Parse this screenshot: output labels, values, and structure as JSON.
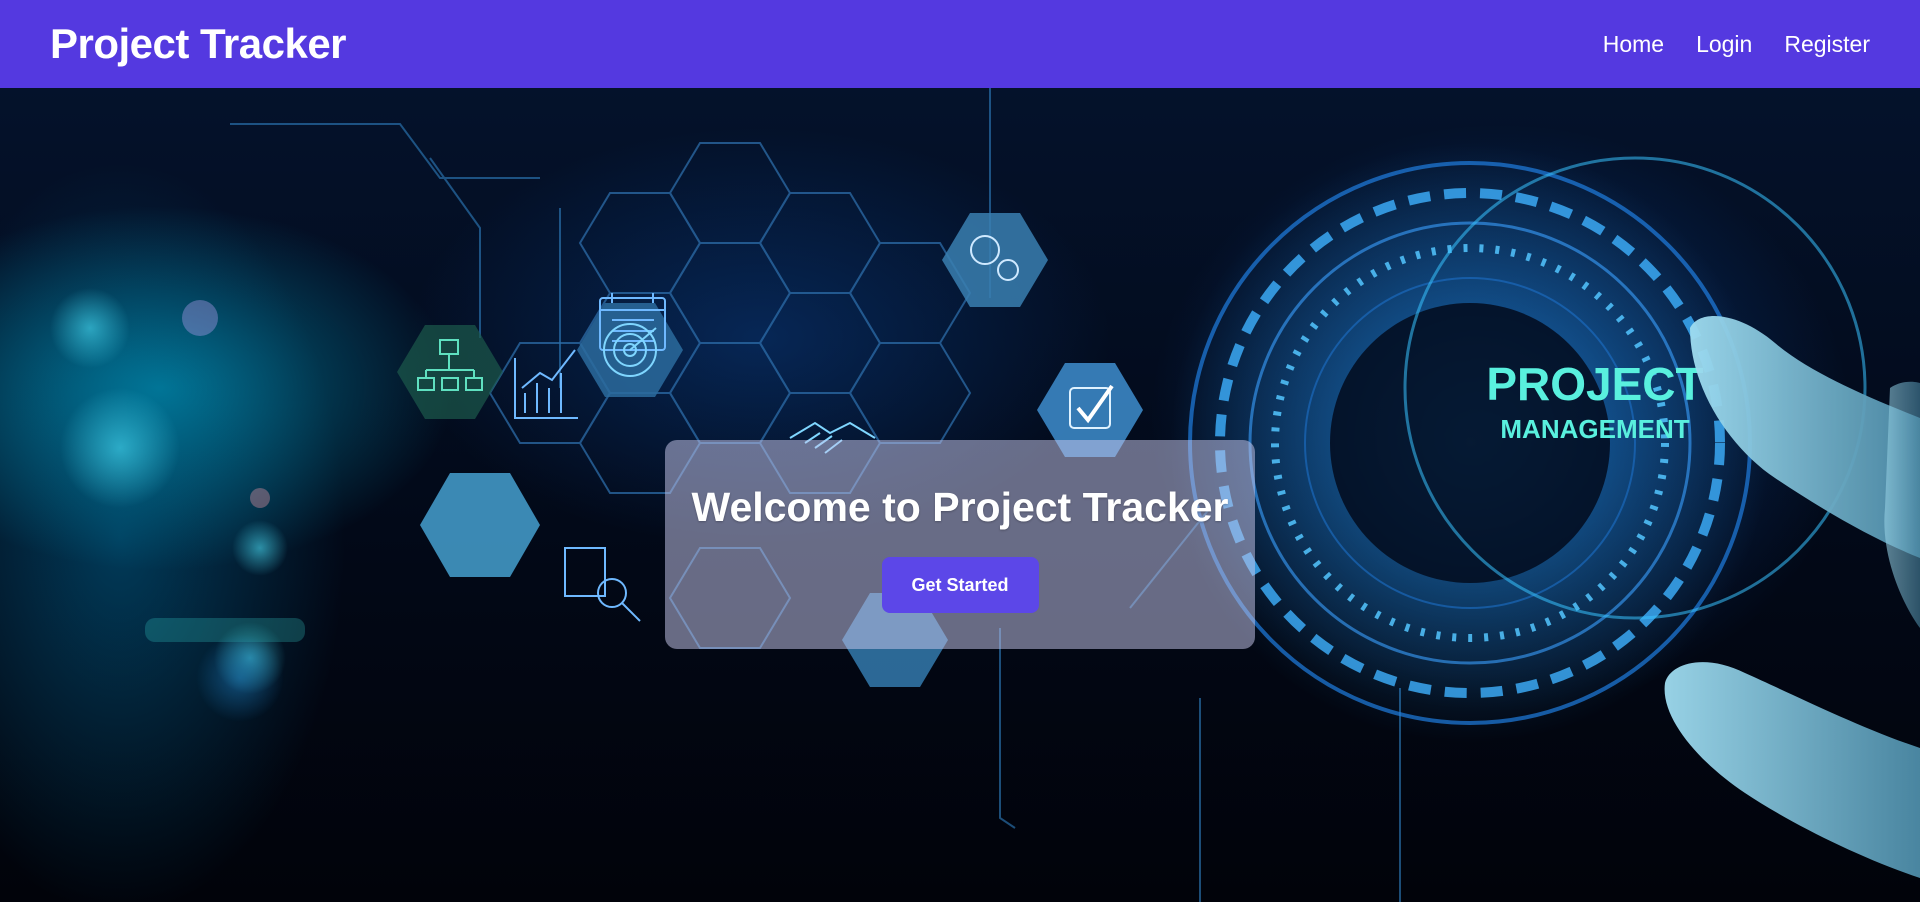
{
  "navbar": {
    "brand": "Project Tracker",
    "links": [
      {
        "label": "Home"
      },
      {
        "label": "Login"
      },
      {
        "label": "Register"
      }
    ],
    "background": "#5439e0"
  },
  "hero": {
    "image_text": {
      "line1": "PROJECT",
      "line2": "MANAGEMENT"
    },
    "card": {
      "title": "Welcome to Project Tracker",
      "button_label": "Get Started",
      "button_color": "#5c47e8"
    }
  },
  "icons": [
    "org-chart-icon",
    "bar-chart-icon",
    "calendar-icon",
    "target-icon",
    "handshake-icon",
    "gears-icon",
    "checkmark-icon",
    "magnifier-icon"
  ]
}
